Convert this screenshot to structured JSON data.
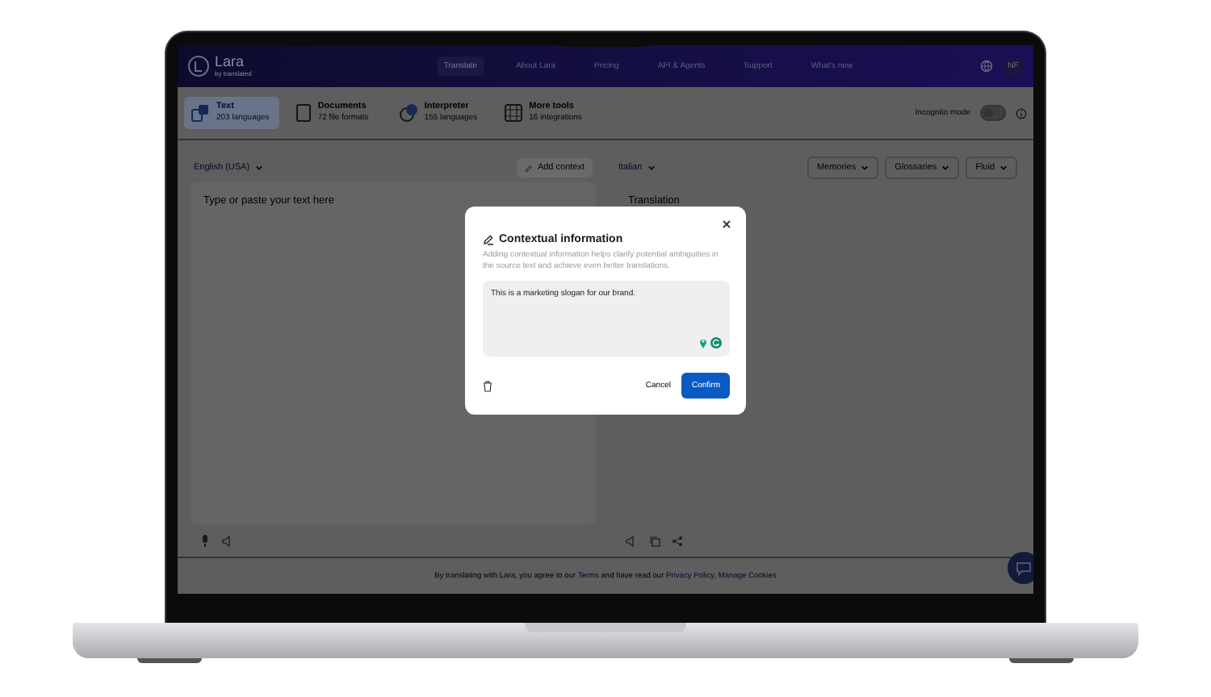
{
  "header": {
    "logo": "Lara",
    "logo_sub": "by translated",
    "avatar": "NF",
    "nav": [
      {
        "label": "Translate",
        "selected": true
      },
      {
        "label": "About Lara",
        "selected": false
      },
      {
        "label": "Pricing",
        "selected": false
      },
      {
        "label": "API & Agents",
        "selected": false
      },
      {
        "label": "Support",
        "selected": false
      },
      {
        "label": "What's new",
        "selected": false
      }
    ]
  },
  "tools": [
    {
      "kind": "text",
      "title": "Text",
      "subtitle": "203 languages",
      "selected": true
    },
    {
      "kind": "documents",
      "title": "Documents",
      "subtitle": "72 file formats",
      "selected": false
    },
    {
      "kind": "interpreter",
      "title": "Interpreter",
      "subtitle": "155 languages",
      "selected": false
    },
    {
      "kind": "more",
      "title": "More tools",
      "subtitle": "16 integrations",
      "selected": false
    }
  ],
  "incognito": {
    "label": "Incognito mode",
    "on": false
  },
  "source": {
    "language": "English (USA)",
    "add_context": "Add context",
    "placeholder": "Type or paste your text here"
  },
  "target": {
    "language": "Italian",
    "placeholder": "Translation",
    "dropdowns": [
      "Memories",
      "Glossaries",
      "Fluid"
    ]
  },
  "footer": [
    {
      "kind": "text",
      "text": "By translating with Lara, you agree to our "
    },
    {
      "kind": "link",
      "text": "Terms"
    },
    {
      "kind": "text",
      "text": " and have read our "
    },
    {
      "kind": "link",
      "text": "Privacy Policy,"
    },
    {
      "kind": "link",
      "text": "Manage Cookies"
    }
  ],
  "modal": {
    "title": "Contextual information",
    "description": "Adding contextual information helps clarify potential ambiguities in the source text and achieve even better translations.",
    "value": "This is a marketing slogan for our brand.",
    "cancel": "Cancel",
    "confirm": "Confirm"
  }
}
